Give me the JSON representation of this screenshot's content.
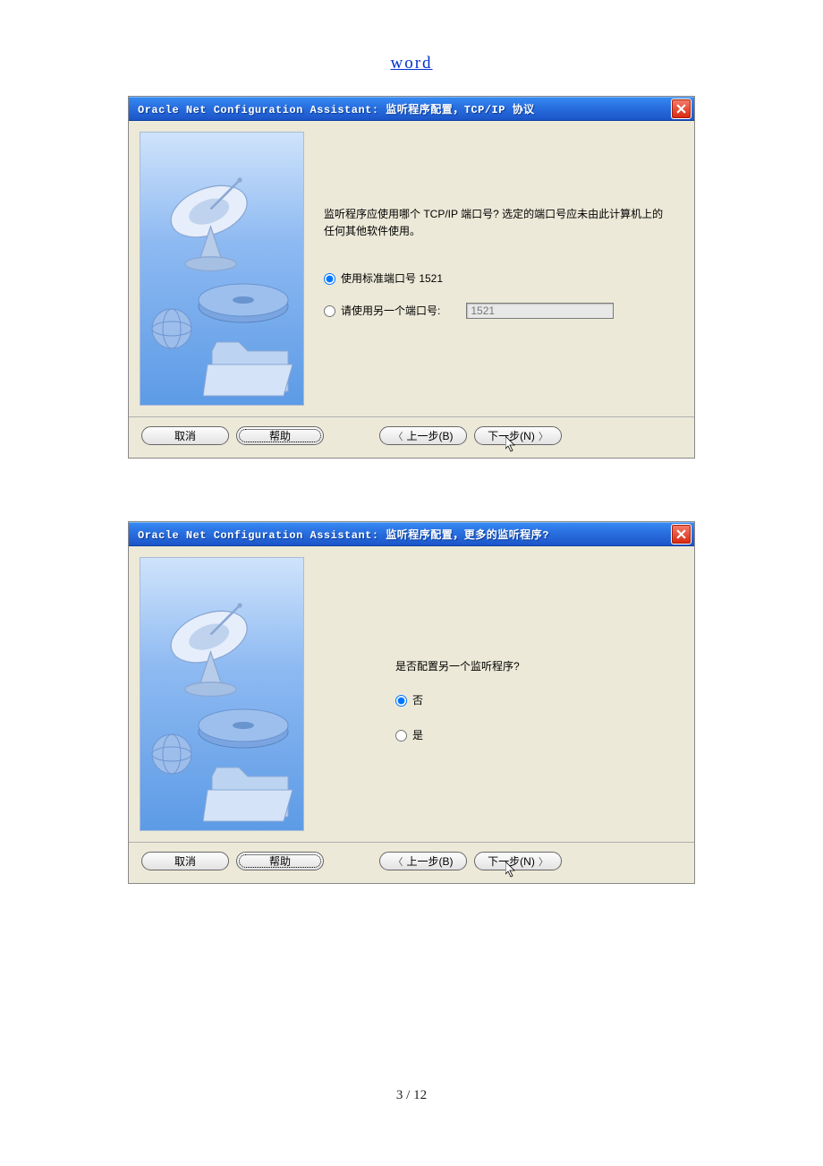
{
  "header_link": "word",
  "page_number": "3 / 12",
  "dialog1": {
    "title": "Oracle Net Configuration Assistant: 监听程序配置，TCP/IP 协议",
    "prompt": "监听程序应使用哪个 TCP/IP 端口号? 选定的端口号应未由此计算机上的任何其他软件使用。",
    "radio_standard": "使用标准端口号 1521",
    "radio_other": "请使用另一个端口号:",
    "port_value": "1521",
    "btn_cancel": "取消",
    "btn_help": "帮助",
    "btn_back": "上一步(B)",
    "btn_next": "下一步(N)"
  },
  "dialog2": {
    "title": "Oracle Net Configuration Assistant: 监听程序配置，更多的监听程序?",
    "prompt": "是否配置另一个监听程序?",
    "radio_no": "否",
    "radio_yes": "是",
    "btn_cancel": "取消",
    "btn_help": "帮助",
    "btn_back": "上一步(B)",
    "btn_next": "下一步(N)"
  }
}
